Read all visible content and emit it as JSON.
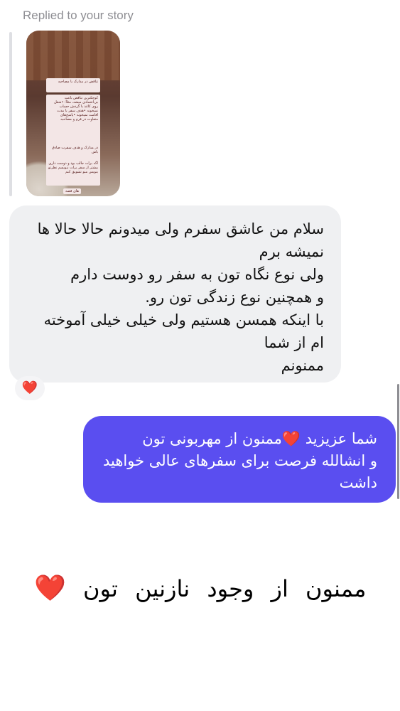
{
  "reply_context": {
    "label": "Replied to your story"
  },
  "story": {
    "cards": [
      "تناقض در مدارک با مصاحبه",
      "کوچکترین تناقض باعث بی‌اعتمادی میشه، مثلاً: •شغل روی کاغذ با گردش حساب نمیخونه •هدف سفر با مدت اقامت نمیخونه •پاسخ‌های متفاوت در فرم و مصاحبه",
      "در مدارک و هدف سفرت صادق باش",
      "اگه برات جالب بود و دوست داری بیشتر از سفر برات بنویسم نظرتو بنویس منو تشویق کنم"
    ],
    "tag": "های قصه"
  },
  "incoming_message": {
    "lines": [
      "سلام من عاشق سفرم ولی میدونم حالا حالا ها",
      "نمیشه برم",
      "ولی نوع نگاه تون به سفر رو دوست دارم",
      "و همچنین نوع زندگی تون رو.",
      "با اینکه همسن هستیم ولی خیلی خیلی آموخته",
      "ام از شما",
      "ممنونم"
    ],
    "reaction": "❤️"
  },
  "outgoing_message": {
    "line1_before_heart": "شما عزیزید",
    "heart": "❤️",
    "line1_after_heart": "ممنون از مهربونی تون",
    "line2": "و انشالله فرصت برای سفرهای عالی خواهید",
    "line3": "داشت"
  },
  "caption": {
    "text": "ممنون از وجود نازنین تون",
    "heart": "❤️"
  },
  "colors": {
    "outgoing_bubble": "#5a4ef0",
    "incoming_bubble": "#eff0f2",
    "heart": "#e0162b",
    "muted_text": "#8e8e93"
  }
}
